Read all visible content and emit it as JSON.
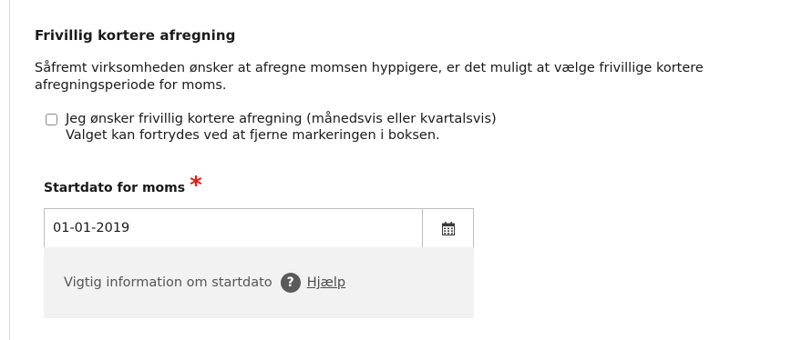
{
  "section": {
    "title": "Frivillig kortere afregning",
    "description": "Såfremt virksomheden ønsker at afregne momsen hyppigere, er det muligt at vælge frivillige kortere afregningsperiode for moms."
  },
  "choice": {
    "checked": false,
    "line1": "Jeg ønsker frivillig kortere afregning (månedsvis eller kvartalsvis)",
    "line2": "Valget kan fortrydes ved at fjerne markeringen i boksen."
  },
  "startdate": {
    "label": "Startdato for moms",
    "required_mark": "*",
    "value": "01-01-2019",
    "calendar_icon": "calendar-icon"
  },
  "info": {
    "text": "Vigtig information om startdato",
    "help_icon_glyph": "?",
    "help_link": "Hjælp"
  },
  "colors": {
    "required": "#e31c1c",
    "info_background": "#f2f2f2",
    "help_icon": "#5a5a5a"
  }
}
